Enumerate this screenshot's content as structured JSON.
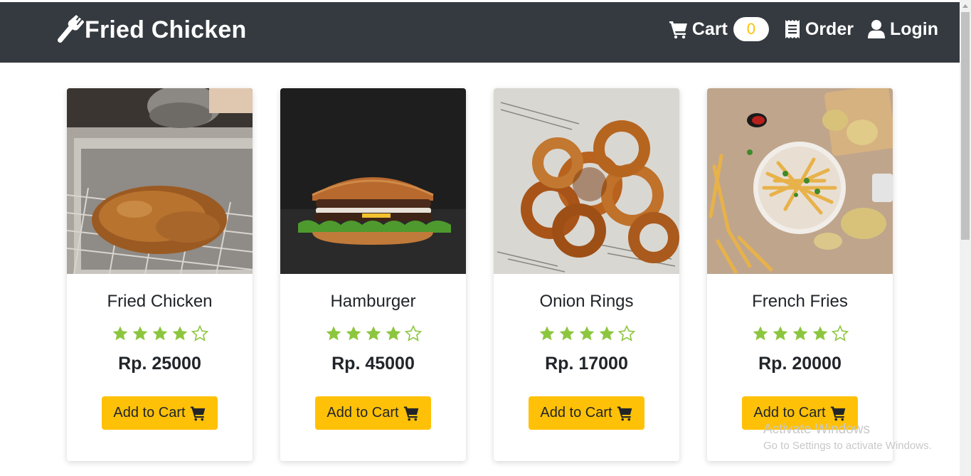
{
  "brand": {
    "name": "Fried Chicken",
    "icon": "utensils-icon"
  },
  "nav": {
    "cart_label": "Cart",
    "cart_count": "0",
    "order_label": "Order",
    "login_label": "Login"
  },
  "products": [
    {
      "name": "Fried Chicken",
      "rating": 4,
      "max_rating": 5,
      "price": "Rp. 25000",
      "button": "Add to Cart",
      "image": "fried-chicken-photo"
    },
    {
      "name": "Hamburger",
      "rating": 4,
      "max_rating": 5,
      "price": "Rp. 45000",
      "button": "Add to Cart",
      "image": "hamburger-photo"
    },
    {
      "name": "Onion Rings",
      "rating": 4,
      "max_rating": 5,
      "price": "Rp. 17000",
      "button": "Add to Cart",
      "image": "onion-rings-photo"
    },
    {
      "name": "French Fries",
      "rating": 4,
      "max_rating": 5,
      "price": "Rp. 20000",
      "button": "Add to Cart",
      "image": "french-fries-photo"
    }
  ],
  "watermark": {
    "line1": "Activate Windows",
    "line2": "Go to Settings to activate Windows."
  },
  "colors": {
    "navbar": "#343a40",
    "button": "#ffc107",
    "star": "#8cc63f",
    "badge_text": "#ffc107"
  }
}
